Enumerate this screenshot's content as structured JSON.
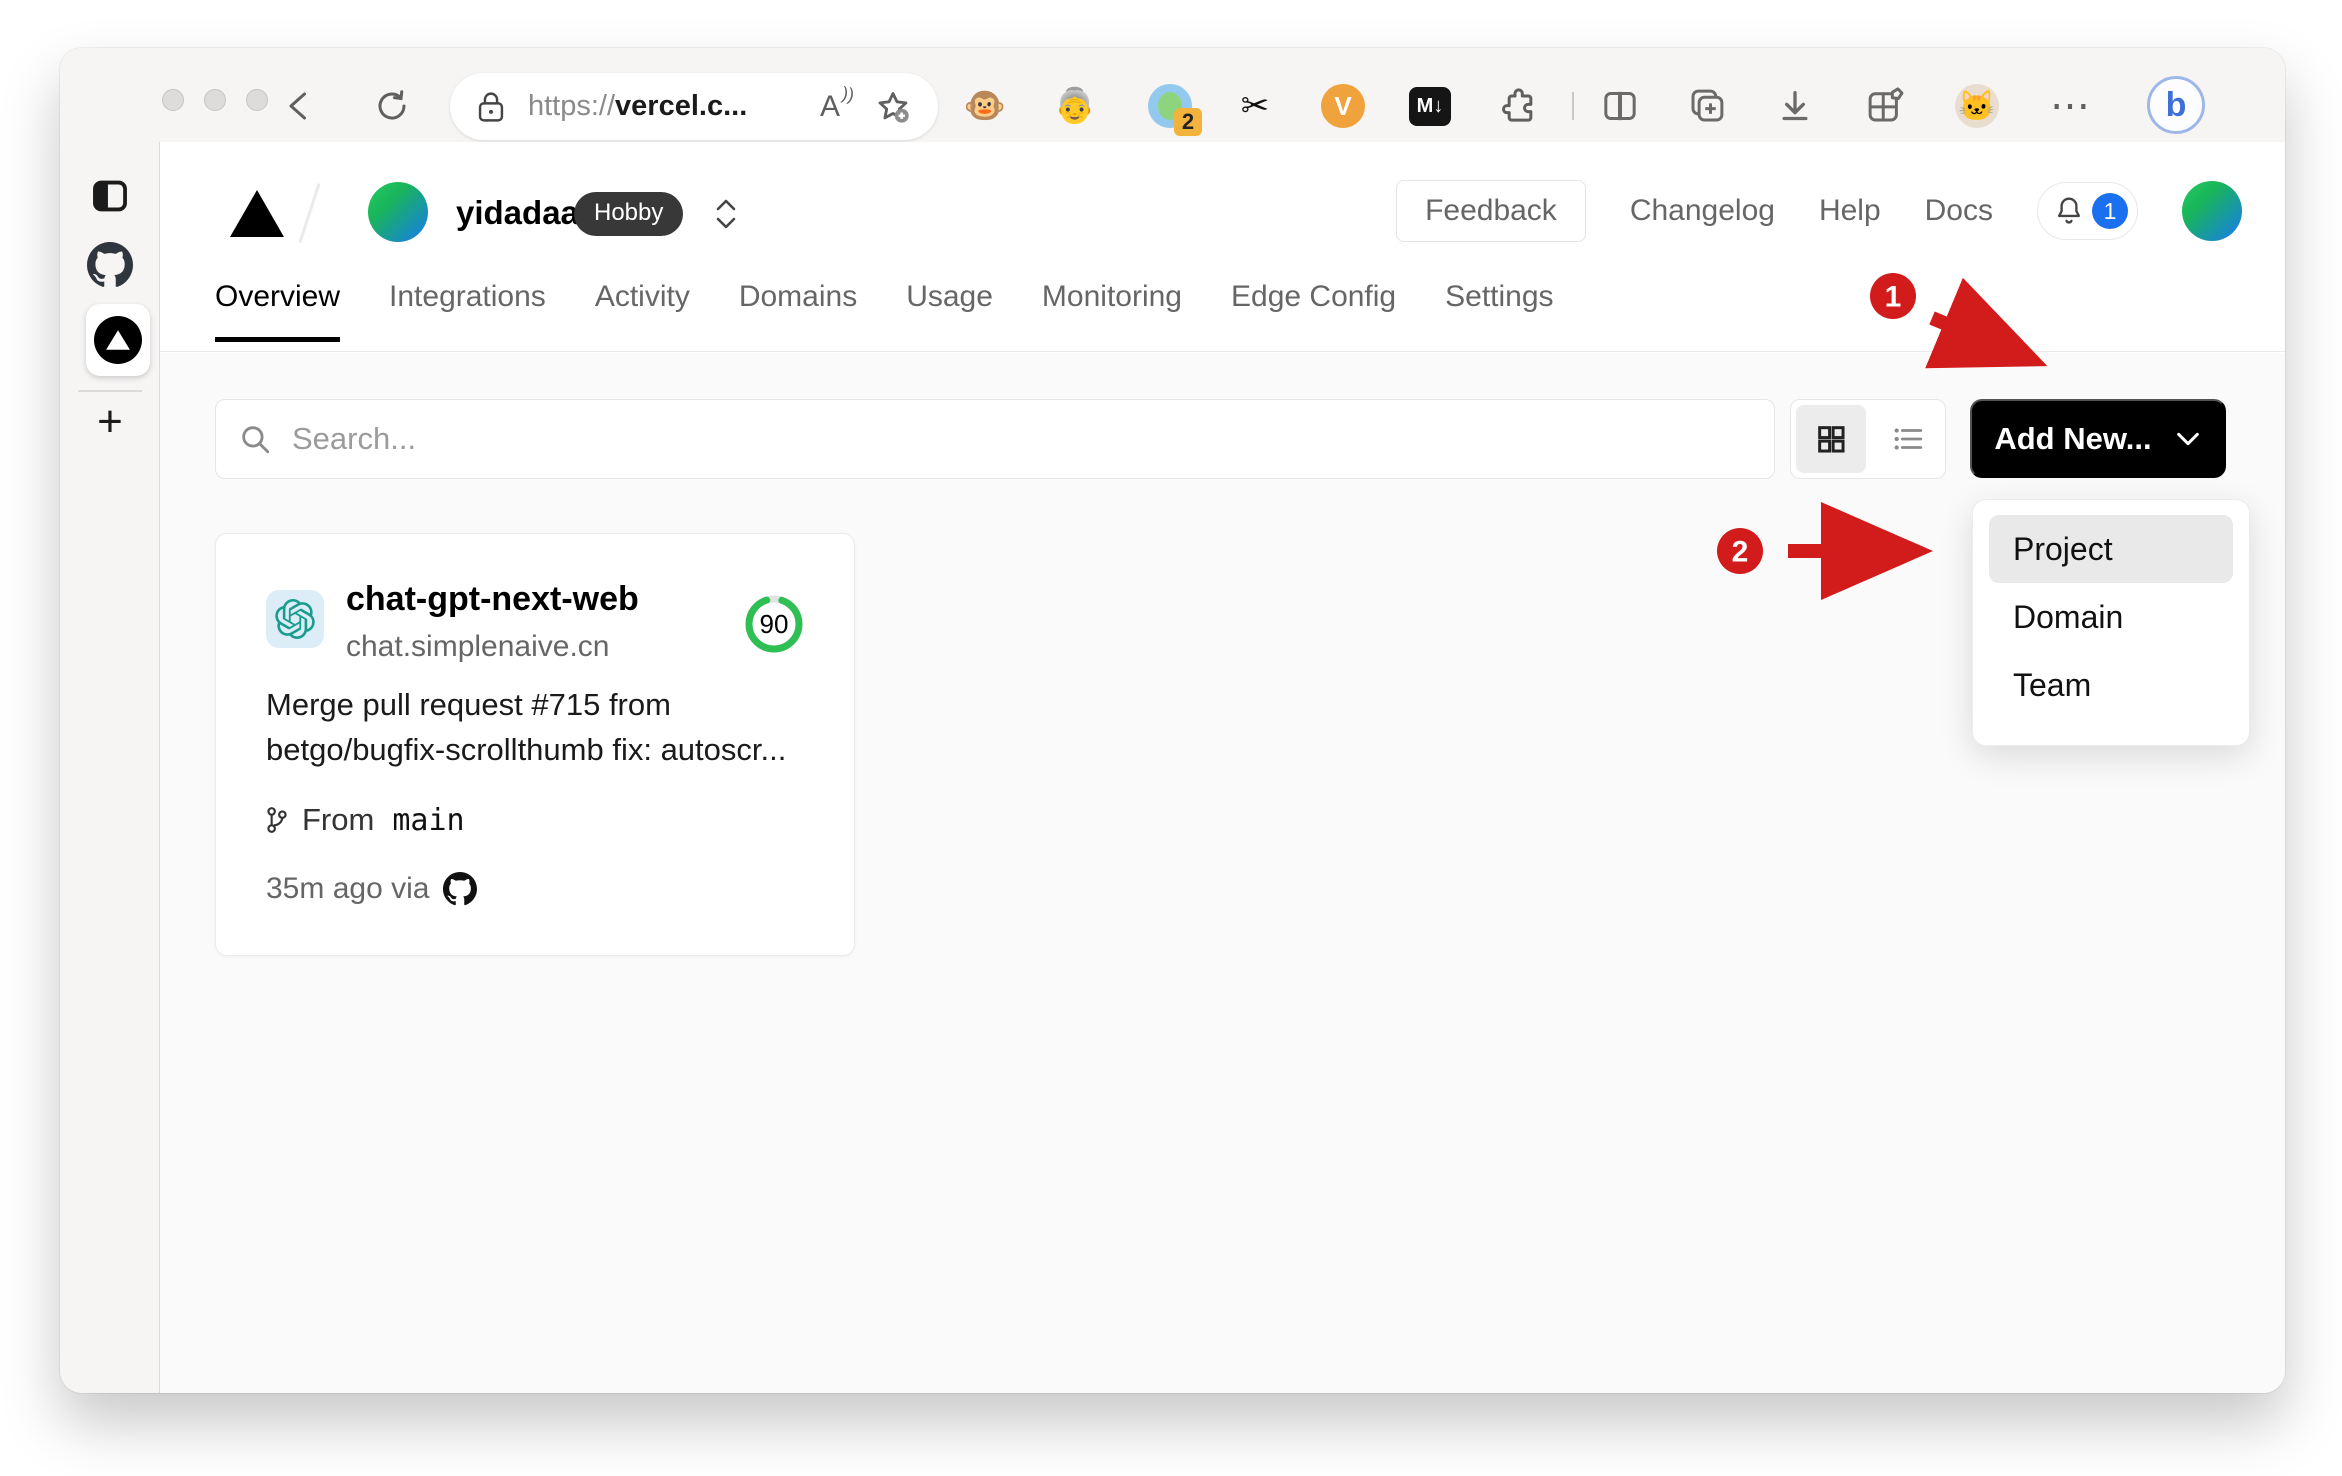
{
  "browser": {
    "address": {
      "scheme": "https://",
      "host": "vercel.c..."
    },
    "read_aloud_glyph": "A",
    "extensions": {
      "monkey_glyph": "🐵",
      "person_glyph": "👵",
      "translate_badge": "2",
      "scissors_glyph": "✂",
      "v_letter": "V",
      "markdown_label": "M↓",
      "cat_glyph": "🐱",
      "more_glyph": "⋯",
      "bing_letter": "b"
    },
    "sidebar": {
      "new_tab_glyph": "+"
    }
  },
  "vercel": {
    "team": {
      "name": "yidadaa",
      "plan": "Hobby"
    },
    "header": {
      "feedback": "Feedback",
      "changelog": "Changelog",
      "help": "Help",
      "docs": "Docs",
      "notification_count": "1"
    },
    "tabs": {
      "items": [
        "Overview",
        "Integrations",
        "Activity",
        "Domains",
        "Usage",
        "Monitoring",
        "Edge Config",
        "Settings"
      ],
      "active": "Overview"
    },
    "toolbar": {
      "search_placeholder": "Search...",
      "add_new_label": "Add New..."
    },
    "dropdown": {
      "items": [
        {
          "label": "Project",
          "highlighted": true
        },
        {
          "label": "Domain",
          "highlighted": false
        },
        {
          "label": "Team",
          "highlighted": false
        }
      ]
    },
    "project_card": {
      "name": "chat-gpt-next-web",
      "domain": "chat.simplenaive.cn",
      "score": "90",
      "commit_line1": "Merge pull request #715 from",
      "commit_line2": "betgo/bugfix-scrollthumb fix: autoscr...",
      "branch_prefix": "From",
      "branch_name": "main",
      "deployed": "35m ago via"
    }
  },
  "annotations": {
    "step1": "1",
    "step2": "2",
    "color": "#d21b1b"
  },
  "colors": {
    "accent_black": "#000000",
    "score_green": "#2fbf54",
    "notification_blue": "#1a70ef",
    "annotation_red": "#d21b1b",
    "chrome_gray": "#f6f5f4",
    "content_gray": "#fafafa"
  }
}
